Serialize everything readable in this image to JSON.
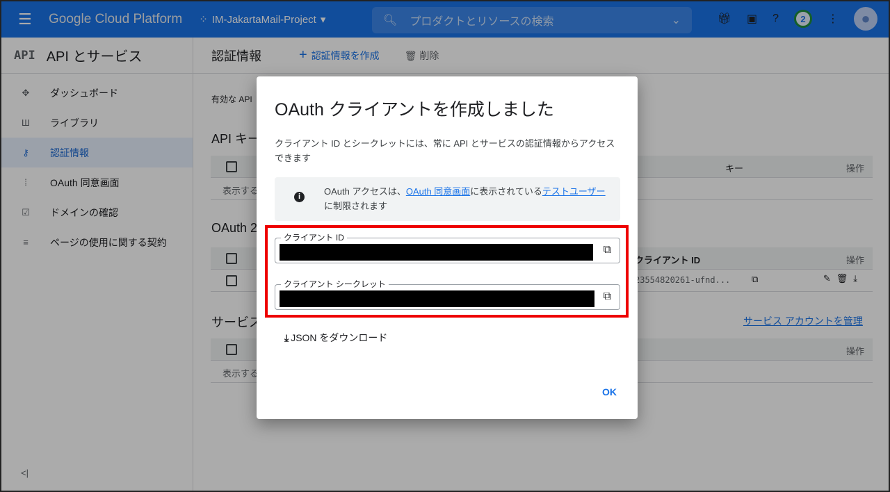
{
  "header": {
    "brand": "Google Cloud Platform",
    "project": "IM-JakartaMail-Project",
    "search_placeholder": "プロダクトとリソースの検索",
    "notification_count": "2"
  },
  "sidebar": {
    "title_icon": "API",
    "title": "API とサービス",
    "items": [
      {
        "label": "ダッシュボード",
        "icon": "dashboard-icon"
      },
      {
        "label": "ライブラリ",
        "icon": "library-icon"
      },
      {
        "label": "認証情報",
        "icon": "key-icon",
        "active": true
      },
      {
        "label": "OAuth 同意画面",
        "icon": "consent-icon"
      },
      {
        "label": "ドメインの確認",
        "icon": "domain-check-icon"
      },
      {
        "label": "ページの使用に関する契約",
        "icon": "settings-list-icon"
      }
    ],
    "collapse": "<|"
  },
  "main": {
    "title": "認証情報",
    "create": "認証情報を作成",
    "delete": "削除",
    "note": "有効な API",
    "api_keys": {
      "title": "API キー",
      "col_key": "キー",
      "col_ops": "操作",
      "empty": "表示する"
    },
    "oauth": {
      "title": "OAuth 2",
      "col_id": "クライアント ID",
      "col_ops": "操作",
      "row_id": "23554820261-ufnd..."
    },
    "service": {
      "title": "サービス",
      "manage_link": "サービス アカウントを管理",
      "col_ops": "操作",
      "empty": "表示する"
    }
  },
  "dialog": {
    "title": "OAuth クライアントを作成しました",
    "description": "クライアント ID とシークレットには、常に API とサービスの認証情報からアクセスできます",
    "info_prefix": "OAuth アクセスは、",
    "info_link1": "OAuth 同意画面",
    "info_mid": "に表示されている",
    "info_link2": "テストユーザー",
    "info_suffix": "に制限されます",
    "client_id_label": "クライアント ID",
    "client_secret_label": "クライアント シークレット",
    "download": "JSON をダウンロード",
    "ok": "OK",
    "highlight_color": "#e00000"
  }
}
